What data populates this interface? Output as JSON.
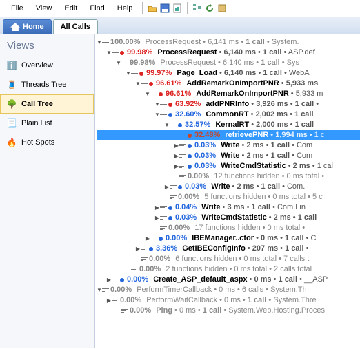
{
  "menu": {
    "file": "File",
    "view": "View",
    "edit": "Edit",
    "find": "Find",
    "help": "Help"
  },
  "tabs": {
    "home": "Home",
    "allcalls": "All Calls"
  },
  "views": {
    "title": "Views",
    "items": [
      {
        "label": "Overview"
      },
      {
        "label": "Threads Tree"
      },
      {
        "label": "Call Tree"
      },
      {
        "label": "Plain List"
      },
      {
        "label": "Hot Spots"
      }
    ]
  },
  "tree": [
    {
      "d": 0,
      "tri": "▼",
      "bars": 1,
      "pct": "100.00%",
      "fn": "ProcessRequest",
      "meta": "6,141 ms  •  1 call  •  System.",
      "gray": true,
      "dot": null
    },
    {
      "d": 1,
      "tri": "▼",
      "bars": 1,
      "pct": "99.98%",
      "fn": "ProcessRequest",
      "meta": "6,140 ms  •  1 call  •  ASP.def",
      "gray": false,
      "dot": "#d22",
      "bold": true
    },
    {
      "d": 2,
      "tri": "▼",
      "bars": 1,
      "pct": "99.98%",
      "fn": "ProcessRequest",
      "meta": "6,140 ms  •  1 call  •  Sys",
      "gray": true,
      "dot": null
    },
    {
      "d": 3,
      "tri": "▼",
      "bars": 1,
      "pct": "99.97%",
      "fn": "Page_Load",
      "meta": "6,140 ms  •  1 call  •  WebA",
      "gray": false,
      "dot": "#d22",
      "bold": true
    },
    {
      "d": 4,
      "tri": "▼",
      "bars": 1,
      "pct": "96.61%",
      "fn": "AddRemarkOnImportPNR",
      "meta": "5,933 ms",
      "gray": false,
      "dot": "#d22",
      "bold": true
    },
    {
      "d": 5,
      "tri": "▼",
      "bars": 1,
      "pct": "96.61%",
      "fn": "AddRemarkOnImportPNR",
      "meta": "5,933 m",
      "gray": false,
      "dot": "#d22",
      "bold": true
    },
    {
      "d": 6,
      "tri": "▼",
      "bars": 1,
      "pct": "63.92%",
      "fn": "addPNRInfo",
      "meta": "3,926 ms  •  1 call  •",
      "gray": false,
      "dot": "#d22",
      "bold": true
    },
    {
      "d": 6,
      "tri": "▼",
      "bars": 1,
      "pct": "32.60%",
      "fn": "CommonRT",
      "meta": "2,002 ms  •  1 call",
      "gray": false,
      "dot": "#26d",
      "bold": true
    },
    {
      "d": 7,
      "tri": "▼",
      "bars": 1,
      "pct": "32.57%",
      "fn": "KernalRT",
      "meta": "2,000 ms  •  1 call",
      "gray": false,
      "dot": "#26d",
      "bold": true
    },
    {
      "d": 8,
      "tri": "",
      "bars": 0,
      "pct": "32.48%",
      "fn": "retrievePNR",
      "meta": "1,994 ms  •  1 c",
      "gray": false,
      "dot": "#c42",
      "sel": true,
      "bold": true
    },
    {
      "d": 8,
      "tri": "▶",
      "bars": 3,
      "pct": "0.03%",
      "fn": "Write",
      "meta": "2 ms  •  1 call  •  Com",
      "gray": false,
      "dot": "#26d",
      "bold": true
    },
    {
      "d": 8,
      "tri": "▶",
      "bars": 3,
      "pct": "0.03%",
      "fn": "Write",
      "meta": "2 ms  •  1 call  •  Com",
      "gray": false,
      "dot": "#26d",
      "bold": true
    },
    {
      "d": 8,
      "tri": "▶",
      "bars": 3,
      "pct": "0.03%",
      "fn": "WriteCmdStatistic",
      "meta": "2 ms  •  1 cal",
      "gray": false,
      "dot": "#26d",
      "bold": true
    },
    {
      "d": 8,
      "tri": "",
      "bars": 3,
      "pct": "0.00%",
      "fn": "12 functions hidden",
      "meta": "0 ms total  •",
      "gray": true,
      "dot": null
    },
    {
      "d": 7,
      "tri": "▶",
      "bars": 3,
      "pct": "0.03%",
      "fn": "Write",
      "meta": "2 ms  •  1 call  •  Com.",
      "gray": false,
      "dot": "#26d",
      "bold": true
    },
    {
      "d": 7,
      "tri": "",
      "bars": 3,
      "pct": "0.00%",
      "fn": "5 functions hidden",
      "meta": "0 ms total  •  5 c",
      "gray": true,
      "dot": null
    },
    {
      "d": 6,
      "tri": "▶",
      "bars": 3,
      "pct": "0.04%",
      "fn": "Write",
      "meta": "3 ms  •  1 call  •  Com.Lin",
      "gray": false,
      "dot": "#26d",
      "bold": true
    },
    {
      "d": 6,
      "tri": "▶",
      "bars": 3,
      "pct": "0.03%",
      "fn": "WriteCmdStatistic",
      "meta": "2 ms  •  1 call",
      "gray": false,
      "dot": "#26d",
      "bold": true
    },
    {
      "d": 6,
      "tri": "",
      "bars": 3,
      "pct": "0.00%",
      "fn": "17 functions hidden",
      "meta": "0 ms total  •",
      "gray": true,
      "dot": null
    },
    {
      "d": 5,
      "tri": "▶",
      "bars": 0,
      "pct": "0.00%",
      "fn": "IBEManager..ctor",
      "meta": "0 ms  •  1 call  •  C",
      "gray": false,
      "dot": "#26d",
      "bold": true
    },
    {
      "d": 4,
      "tri": "▶",
      "bars": 2,
      "pct": "3.36%",
      "fn": "GetIBEConfigInfo",
      "meta": "207 ms  •  1 call  •",
      "gray": false,
      "dot": "#26d",
      "bold": true
    },
    {
      "d": 4,
      "tri": "",
      "bars": 3,
      "pct": "0.00%",
      "fn": "6 functions hidden",
      "meta": "0 ms total  •  7 calls t",
      "gray": true,
      "dot": null
    },
    {
      "d": 3,
      "tri": "",
      "bars": 3,
      "pct": "0.00%",
      "fn": "2 functions hidden",
      "meta": "0 ms total  •  2 calls total",
      "gray": true,
      "dot": null
    },
    {
      "d": 1,
      "tri": "▶",
      "bars": 0,
      "pct": "0.00%",
      "fn": "Create_ASP_default_aspx",
      "meta": "0 ms  •  1 call  •  __ASP",
      "gray": false,
      "dot": "#26d",
      "bold": true
    },
    {
      "d": 0,
      "tri": "▼",
      "bars": 3,
      "pct": "0.00%",
      "fn": "PerformTimerCallback",
      "meta": "0 ms  •  6 calls  •  System.Th",
      "gray": true,
      "dot": null
    },
    {
      "d": 1,
      "tri": "▶",
      "bars": 3,
      "pct": "0.00%",
      "fn": "PerformWaitCallback",
      "meta": "0 ms  •  1 call  •  System.Thre",
      "gray": true,
      "dot": null
    },
    {
      "d": 2,
      "tri": "",
      "bars": 3,
      "pct": "0.00%",
      "fn": "Ping",
      "meta": "0 ms  •  1 call  •  System.Web.Hosting.Proces",
      "gray": true,
      "dot": null,
      "bold": true
    }
  ]
}
